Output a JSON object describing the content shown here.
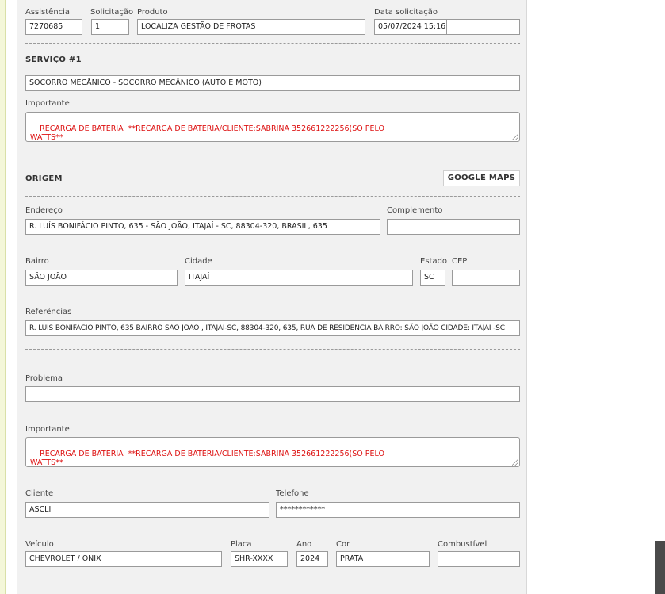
{
  "header": {
    "assistencia_label": "Assistência",
    "assistencia_value": "7270685",
    "solicitacao_label": "Solicitação",
    "solicitacao_value": "1",
    "produto_label": "Produto",
    "produto_value": "LOCALIZA GESTÃO DE FROTAS",
    "data_label": "Data solicitação",
    "data_value": "05/07/2024 15:16",
    "data_extra_value": ""
  },
  "servico": {
    "title": "SERVIÇO #1",
    "service_value": "SOCORRO MECÂNICO - SOCORRO MECÂNICO (AUTO E MOTO)",
    "importante_label": "Importante",
    "importante_value": "RECARGA DE BATERIA  **RECARGA DE BATERIA/CLIENTE:SABRINA 352661222256(SO PELO\nWATTS**"
  },
  "origem": {
    "title": "ORIGEM",
    "maps_button": "GOOGLE MAPS",
    "endereco_label": "Endereço",
    "endereco_value": "R. LUÍS BONIFÁCIO PINTO, 635 - SÃO JOÃO, ITAJAÍ - SC, 88304-320, BRASIL, 635",
    "complemento_label": "Complemento",
    "complemento_value": "",
    "bairro_label": "Bairro",
    "bairro_value": "SÃO JOÃO",
    "cidade_label": "Cidade",
    "cidade_value": "ITAJAÍ",
    "estado_label": "Estado",
    "estado_value": "SC",
    "cep_label": "CEP",
    "cep_value": "",
    "referencias_label": "Referências",
    "referencias_value": "R. LUIS BONIFACIO PINTO, 635 BAIRRO SAO JOAO , ITAJAI-SC, 88304-320, 635, RUA DE RESIDENCIA BAIRRO: SÃO JOÃO CIDADE: ITAJAI -SC"
  },
  "detalhes": {
    "problema_label": "Problema",
    "problema_value": "",
    "importante_label": "Importante",
    "importante_value": "RECARGA DE BATERIA  **RECARGA DE BATERIA/CLIENTE:SABRINA 352661222256(SO PELO\nWATTS**",
    "cliente_label": "Cliente",
    "cliente_value": "ASCLI",
    "telefone_label": "Telefone",
    "telefone_value": "************",
    "veiculo_label": "Veículo",
    "veiculo_value": "CHEVROLET / ONIX",
    "placa_label": "Placa",
    "placa_value": "SHR-XXXX",
    "ano_label": "Ano",
    "ano_value": "2024",
    "cor_label": "Cor",
    "cor_value": "PRATA",
    "combustivel_label": "Combustível",
    "combustivel_value": ""
  },
  "colors": {
    "panel_bg": "#f1f1f1",
    "important_text": "#dd1111",
    "field_border": "#9a9a9a"
  }
}
